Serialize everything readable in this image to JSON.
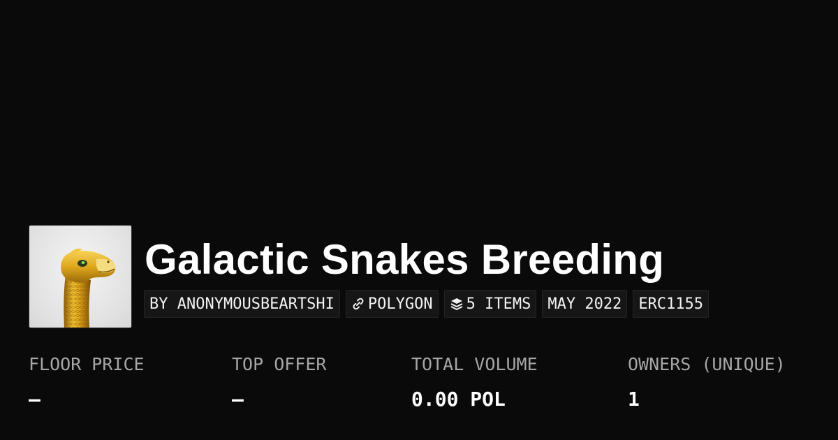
{
  "collection": {
    "title": "Galactic Snakes Breeding",
    "avatar_icon": "golden-snake-image"
  },
  "tags": {
    "creator": "BY ANONYMOUSBEARTSHI",
    "chain": "POLYGON",
    "chain_icon": "link-icon",
    "items": "5 ITEMS",
    "items_icon": "layers-icon",
    "date": "MAY 2022",
    "standard": "ERC1155"
  },
  "stats": {
    "floor_price": {
      "label": "FLOOR PRICE",
      "value": "—"
    },
    "top_offer": {
      "label": "TOP OFFER",
      "value": "—"
    },
    "total_volume": {
      "label": "TOTAL VOLUME",
      "value": "0.00 POL"
    },
    "owners": {
      "label": "OWNERS (UNIQUE)",
      "value": "1"
    }
  },
  "colors": {
    "background": "#0a0a0a",
    "tag_background": "#161616",
    "label_gray": "#a6a6a6",
    "text_white": "#ffffff",
    "gold": "#d4a017"
  }
}
